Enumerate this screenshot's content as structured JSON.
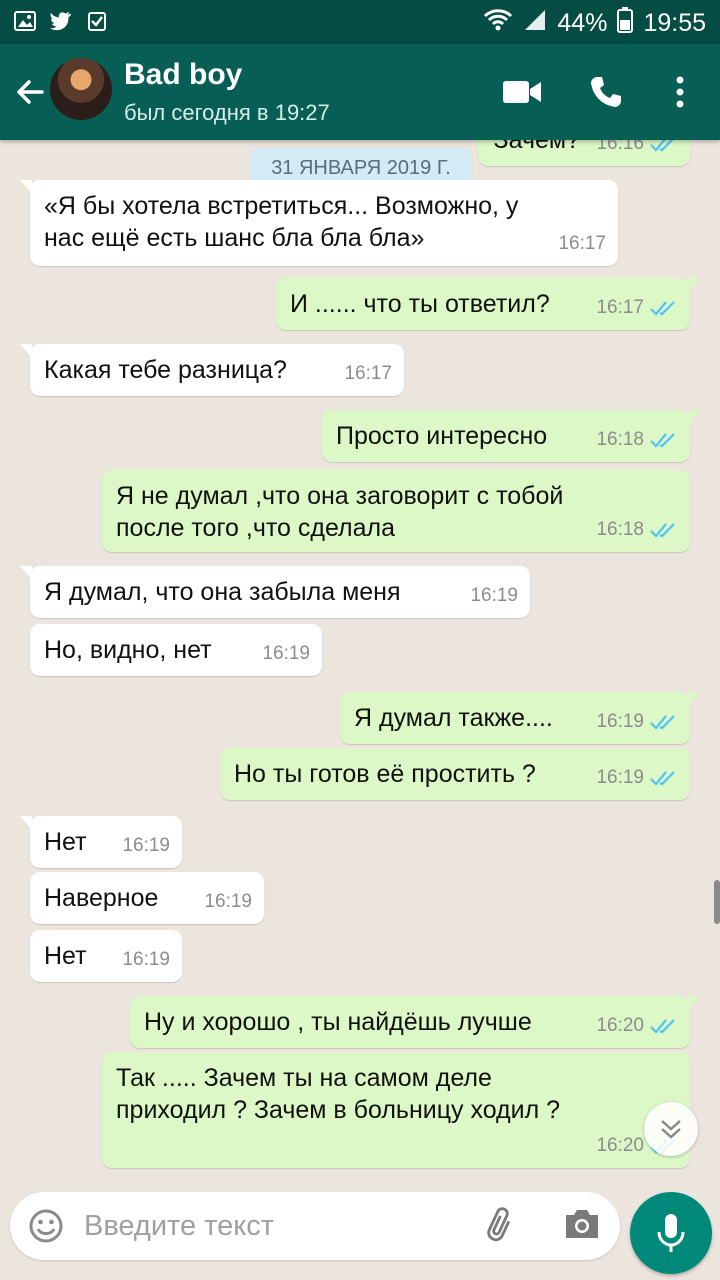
{
  "status_bar": {
    "battery": "44%",
    "time": "19:55",
    "left_icons": [
      "gallery-icon",
      "twitter-icon",
      "checkbox-icon"
    ],
    "right_icons": [
      "wifi-icon",
      "signal-icon",
      "battery-icon"
    ]
  },
  "header": {
    "name": "Bad boy",
    "last_seen": "был сегодня в 19:27"
  },
  "partial_top": {
    "text": "Зачем?",
    "time": "16:16"
  },
  "date_pill": "31 ЯНВАРЯ 2019 Г.",
  "messages": [
    {
      "dir": "in",
      "text": "«Я бы хотела встретиться... Возможно, у\nнас ещё есть шанс бла бла бла»",
      "time": "16:17"
    },
    {
      "dir": "out",
      "text": "И ...... что ты ответил?",
      "time": "16:17"
    },
    {
      "dir": "in",
      "text": "Какая тебе разница?",
      "time": "16:17"
    },
    {
      "dir": "out",
      "text": "Просто интересно",
      "time": "16:18"
    },
    {
      "dir": "out",
      "text": "Я не думал ,что она заговорит с тобой\nпосле того ,что сделала",
      "time": "16:18"
    },
    {
      "dir": "in",
      "text": "Я думал, что она забыла меня",
      "time": "16:19"
    },
    {
      "dir": "in",
      "text": "Но, видно, нет",
      "time": "16:19"
    },
    {
      "dir": "out",
      "text": "Я думал также....",
      "time": "16:19"
    },
    {
      "dir": "out",
      "text": "Но ты готов её простить ?",
      "time": "16:19"
    },
    {
      "dir": "in",
      "text": "Нет",
      "time": "16:19"
    },
    {
      "dir": "in",
      "text": "Наверное",
      "time": "16:19"
    },
    {
      "dir": "in",
      "text": "Нет",
      "time": "16:19"
    },
    {
      "dir": "out",
      "text": "Ну и хорошо , ты найдёшь лучше",
      "time": "16:20"
    },
    {
      "dir": "out",
      "text": "Так ..... Зачем ты на самом деле\nприходил ? Зачем в больницу ходил ?",
      "time": "16:20"
    }
  ],
  "input": {
    "placeholder": "Введите текст"
  },
  "colors": {
    "header": "#075e54",
    "status_bar": "#054d44",
    "bubble_out": "#dcf8c6",
    "bubble_in": "#ffffff",
    "accent": "#00897b",
    "tick_read": "#4fc3f7"
  }
}
